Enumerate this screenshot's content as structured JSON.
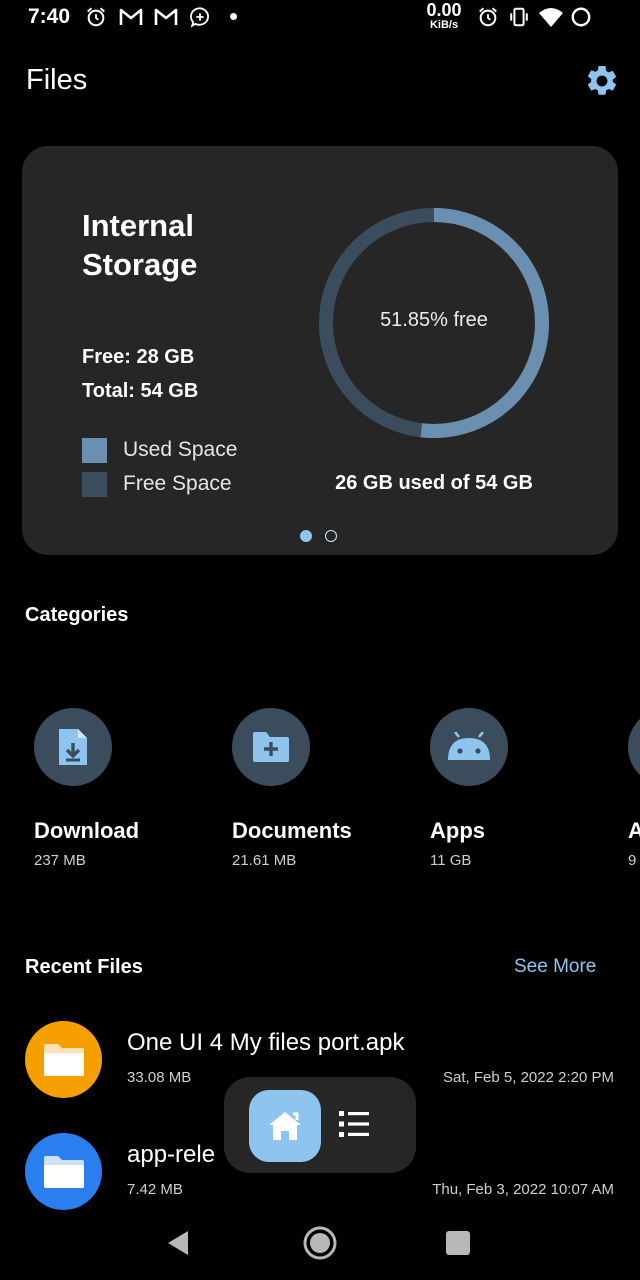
{
  "status_bar": {
    "time": "7:40",
    "net_speed": "0.00",
    "net_unit": "KiB/s",
    "left_icons": [
      "alarm-icon",
      "gmail-icon",
      "gmail-icon",
      "messenger-icon"
    ],
    "right_icons": [
      "alarm-icon",
      "vibrate-icon",
      "wifi-icon",
      "battery-icon"
    ]
  },
  "header": {
    "title": "Files",
    "settings_icon": "gear-icon"
  },
  "storage_card": {
    "title": "Internal Storage",
    "free": "Free: 28 GB",
    "total": "Total: 54 GB",
    "legend_used": "Used Space",
    "legend_free": "Free Space",
    "free_label": "51.85% free",
    "free_fraction": 0.5185,
    "used_of": "26 GB used of 54 GB",
    "pages": 2,
    "active_page": 1
  },
  "categories": {
    "title": "Categories",
    "items": [
      {
        "name": "Download",
        "size": "237 MB",
        "icon": "download-file-icon"
      },
      {
        "name": "Documents",
        "size": "21.61 MB",
        "icon": "folder-plus-icon"
      },
      {
        "name": "Apps",
        "size": "11 GB",
        "icon": "android-icon"
      },
      {
        "name": "A",
        "size": "9",
        "icon": "category-icon"
      }
    ]
  },
  "recent_files": {
    "title": "Recent Files",
    "see_more": "See More",
    "items": [
      {
        "name": "One UI 4 My files port.apk",
        "size": "33.08 MB",
        "date": "Sat, Feb 5, 2022 2:20 PM",
        "icon": "folder-icon"
      },
      {
        "name": "app-rele",
        "size": "7.42 MB",
        "date": "Thu, Feb 3, 2022 10:07 AM",
        "icon": "folder-icon"
      }
    ]
  },
  "bottom_nav": {
    "home_icon": "home-icon",
    "list_icon": "list-icon"
  },
  "system_nav": {
    "back_icon": "back-icon",
    "home_icon": "home-circle-icon",
    "recents_icon": "recents-icon"
  },
  "colors": {
    "background": "#000000",
    "card": "#262626",
    "accent": "#8ec5ef",
    "used_space": "#6a8fb0",
    "free_space": "#3b4d5c",
    "category_circle": "#3b4d5c",
    "apk_orange": "#f5a000",
    "folder_blue": "#2a7ef0"
  }
}
